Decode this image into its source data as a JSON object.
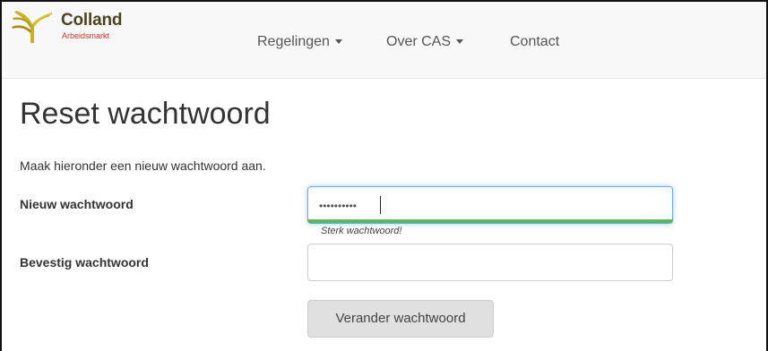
{
  "brand": {
    "name": "Colland",
    "subtitle": "Arbeidsmarkt",
    "accent": "#c0392b",
    "name_color": "#4b4320"
  },
  "nav": {
    "items": [
      {
        "label": "Regelingen",
        "dropdown": true
      },
      {
        "label": "Over CAS",
        "dropdown": true
      },
      {
        "label": "Contact",
        "dropdown": false
      }
    ]
  },
  "page": {
    "title": "Reset wachtwoord",
    "intro": "Maak hieronder een nieuw wachtwoord aan."
  },
  "form": {
    "new_password": {
      "label": "Nieuw wachtwoord",
      "value_masked": "••••••••••",
      "strength_text": "Sterk wachtwoord!",
      "strength_color": "#5cb85c"
    },
    "confirm_password": {
      "label": "Bevestig wachtwoord",
      "value": ""
    },
    "submit_label": "Verander wachtwoord"
  }
}
